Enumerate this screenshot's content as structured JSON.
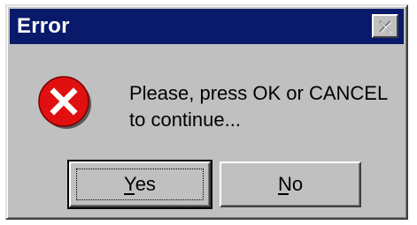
{
  "window": {
    "title": "Error"
  },
  "message": {
    "line1": "Please, press OK or CANCEL",
    "line2": "to continue..."
  },
  "buttons": {
    "yes_label": "Yes",
    "no_label": "No"
  },
  "icons": {
    "error": "error-icon",
    "close": "close-icon"
  },
  "colors": {
    "titlebar": "#0a1a6b",
    "dialog_bg": "#c0c0c0",
    "error_red": "#e01010"
  }
}
